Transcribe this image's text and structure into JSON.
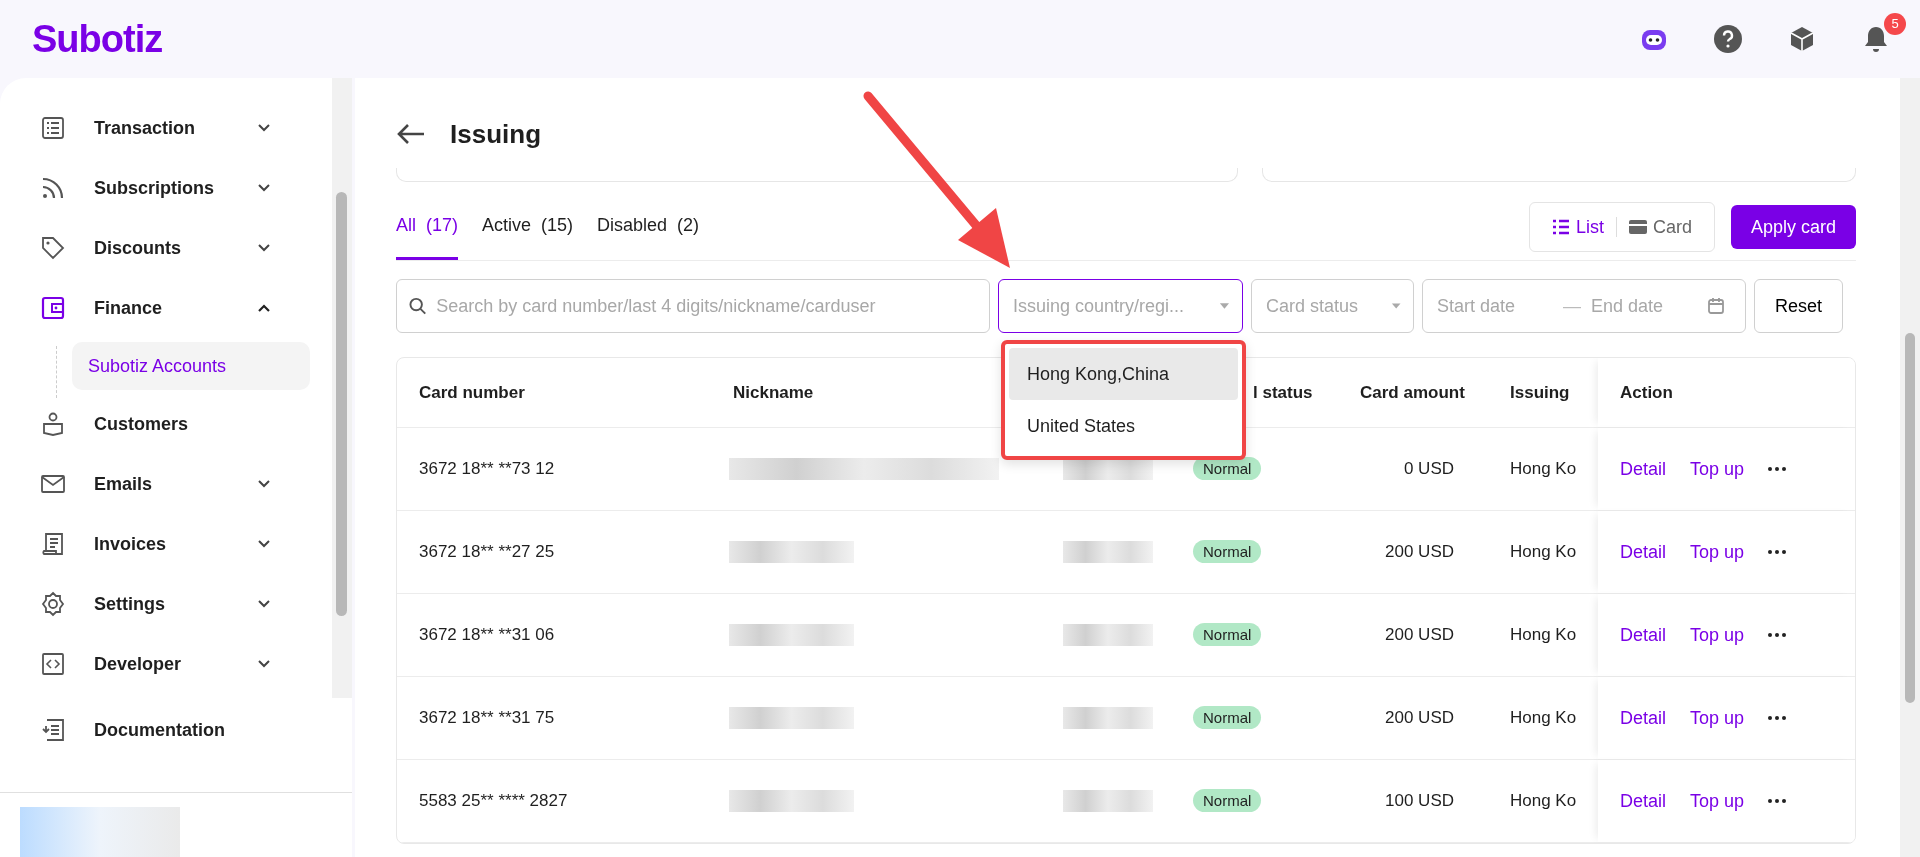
{
  "header": {
    "logo": "Subotiz",
    "notification_count": "5"
  },
  "sidebar": {
    "items": [
      {
        "label": "Transaction",
        "kind": "group",
        "expanded": false,
        "selected": false
      },
      {
        "label": "Subscriptions",
        "kind": "group",
        "expanded": false,
        "selected": false
      },
      {
        "label": "Discounts",
        "kind": "group",
        "expanded": false,
        "selected": false
      },
      {
        "label": "Finance",
        "kind": "group",
        "expanded": true,
        "selected": true,
        "children": [
          {
            "label": "Subotiz Accounts",
            "selected": true
          }
        ]
      },
      {
        "label": "Customers",
        "kind": "link",
        "selected": false
      },
      {
        "label": "Emails",
        "kind": "group",
        "expanded": false,
        "selected": false
      },
      {
        "label": "Invoices",
        "kind": "group",
        "expanded": false,
        "selected": false
      },
      {
        "label": "Settings",
        "kind": "group",
        "expanded": false,
        "selected": false
      },
      {
        "label": "Developer",
        "kind": "group",
        "expanded": false,
        "selected": false
      }
    ],
    "footer_item": {
      "label": "Documentation"
    }
  },
  "page": {
    "title": "Issuing",
    "tabs": [
      {
        "label": "All",
        "count": "(17)",
        "selected": true
      },
      {
        "label": "Active",
        "count": "(15)",
        "selected": false
      },
      {
        "label": "Disabled",
        "count": "(2)",
        "selected": false
      }
    ],
    "view_toggle": [
      {
        "label": "List",
        "selected": true
      },
      {
        "label": "Card",
        "selected": false
      }
    ],
    "apply_button": "Apply card",
    "filters": {
      "search": {
        "placeholder": "Search by card number/last 4 digits/nickname/carduser"
      },
      "country": {
        "placeholder": "Issuing country/regi..."
      },
      "status": {
        "placeholder": "Card status"
      },
      "start_date": {
        "placeholder": "Start date"
      },
      "separator": "—",
      "end_date": {
        "placeholder": "End date"
      },
      "reset": "Reset"
    },
    "country_dropdown": [
      {
        "label": "Hong Kong,China",
        "selected": true
      },
      {
        "label": "United States",
        "selected": false
      }
    ],
    "table": {
      "columns": [
        "Card number",
        "Nickname",
        "l status",
        "Card amount",
        "Issuing",
        "Action"
      ],
      "rows": [
        {
          "card_number": "3672 18** **73 12",
          "status": "Normal",
          "amount": "0 USD",
          "issuing": "Hong Ko",
          "actions": [
            "Detail",
            "Top up"
          ]
        },
        {
          "card_number": "3672 18** **27 25",
          "status": "Normal",
          "amount": "200 USD",
          "issuing": "Hong Ko",
          "actions": [
            "Detail",
            "Top up"
          ]
        },
        {
          "card_number": "3672 18** **31 06",
          "status": "Normal",
          "amount": "200 USD",
          "issuing": "Hong Ko",
          "actions": [
            "Detail",
            "Top up"
          ]
        },
        {
          "card_number": "3672 18** **31 75",
          "status": "Normal",
          "amount": "200 USD",
          "issuing": "Hong Ko",
          "actions": [
            "Detail",
            "Top up"
          ]
        },
        {
          "card_number": "5583 25** **** 2827",
          "status": "Normal",
          "amount": "100 USD",
          "issuing": "Hong Ko",
          "actions": [
            "Detail",
            "Top up"
          ]
        }
      ]
    }
  }
}
